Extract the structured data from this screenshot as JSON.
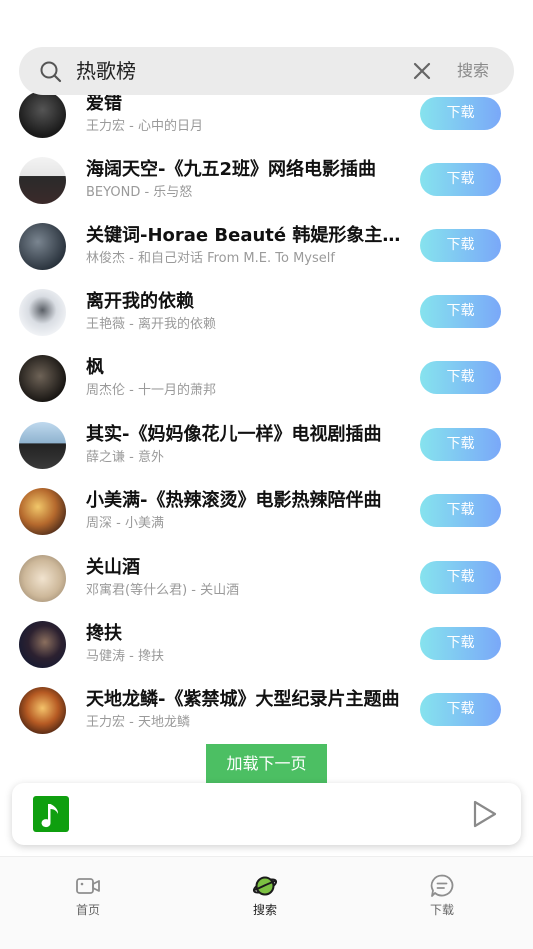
{
  "search": {
    "query": "热歌榜",
    "submit_label": "搜索",
    "icon": "search-icon",
    "clear_icon": "close-icon"
  },
  "songs": [
    {
      "title": "爱错",
      "subtitle": "王力宏 - 心中的日月",
      "button": "下载"
    },
    {
      "title": "海阔天空-《九五2班》网络电影插曲",
      "subtitle": "BEYOND - 乐与怒",
      "button": "下载"
    },
    {
      "title": "关键词-Horae Beauté 韩媞形象主题曲",
      "subtitle": "林俊杰 - 和自己对话 From M.E. To Myself",
      "button": "下载"
    },
    {
      "title": "离开我的依赖",
      "subtitle": "王艳薇 - 离开我的依赖",
      "button": "下载"
    },
    {
      "title": "枫",
      "subtitle": "周杰伦 - 十一月的萧邦",
      "button": "下载"
    },
    {
      "title": "其实-《妈妈像花儿一样》电视剧插曲",
      "subtitle": "薛之谦 - 意外",
      "button": "下载"
    },
    {
      "title": "小美满-《热辣滚烫》电影热辣陪伴曲",
      "subtitle": "周深 - 小美满",
      "button": "下载"
    },
    {
      "title": "关山酒",
      "subtitle": "邓寓君(等什么君) - 关山酒",
      "button": "下载"
    },
    {
      "title": "搀扶",
      "subtitle": "马健涛 - 搀扶",
      "button": "下载"
    },
    {
      "title": "天地龙鳞-《紫禁城》大型纪录片主题曲",
      "subtitle": "王力宏 - 天地龙鳞",
      "button": "下载"
    }
  ],
  "load_more_label": "加载下一页",
  "player": {
    "cover_icon": "music-note-icon",
    "play_icon": "play-icon"
  },
  "tabs": [
    {
      "label": "首页",
      "icon": "video-icon"
    },
    {
      "label": "搜索",
      "icon": "planet-icon"
    },
    {
      "label": "下载",
      "icon": "message-icon"
    }
  ],
  "colors": {
    "download_gradient_start": "#86e3ee",
    "download_gradient_end": "#7aa8f8",
    "load_more": "#4cbf63",
    "player_cover": "#0f9f0f"
  }
}
